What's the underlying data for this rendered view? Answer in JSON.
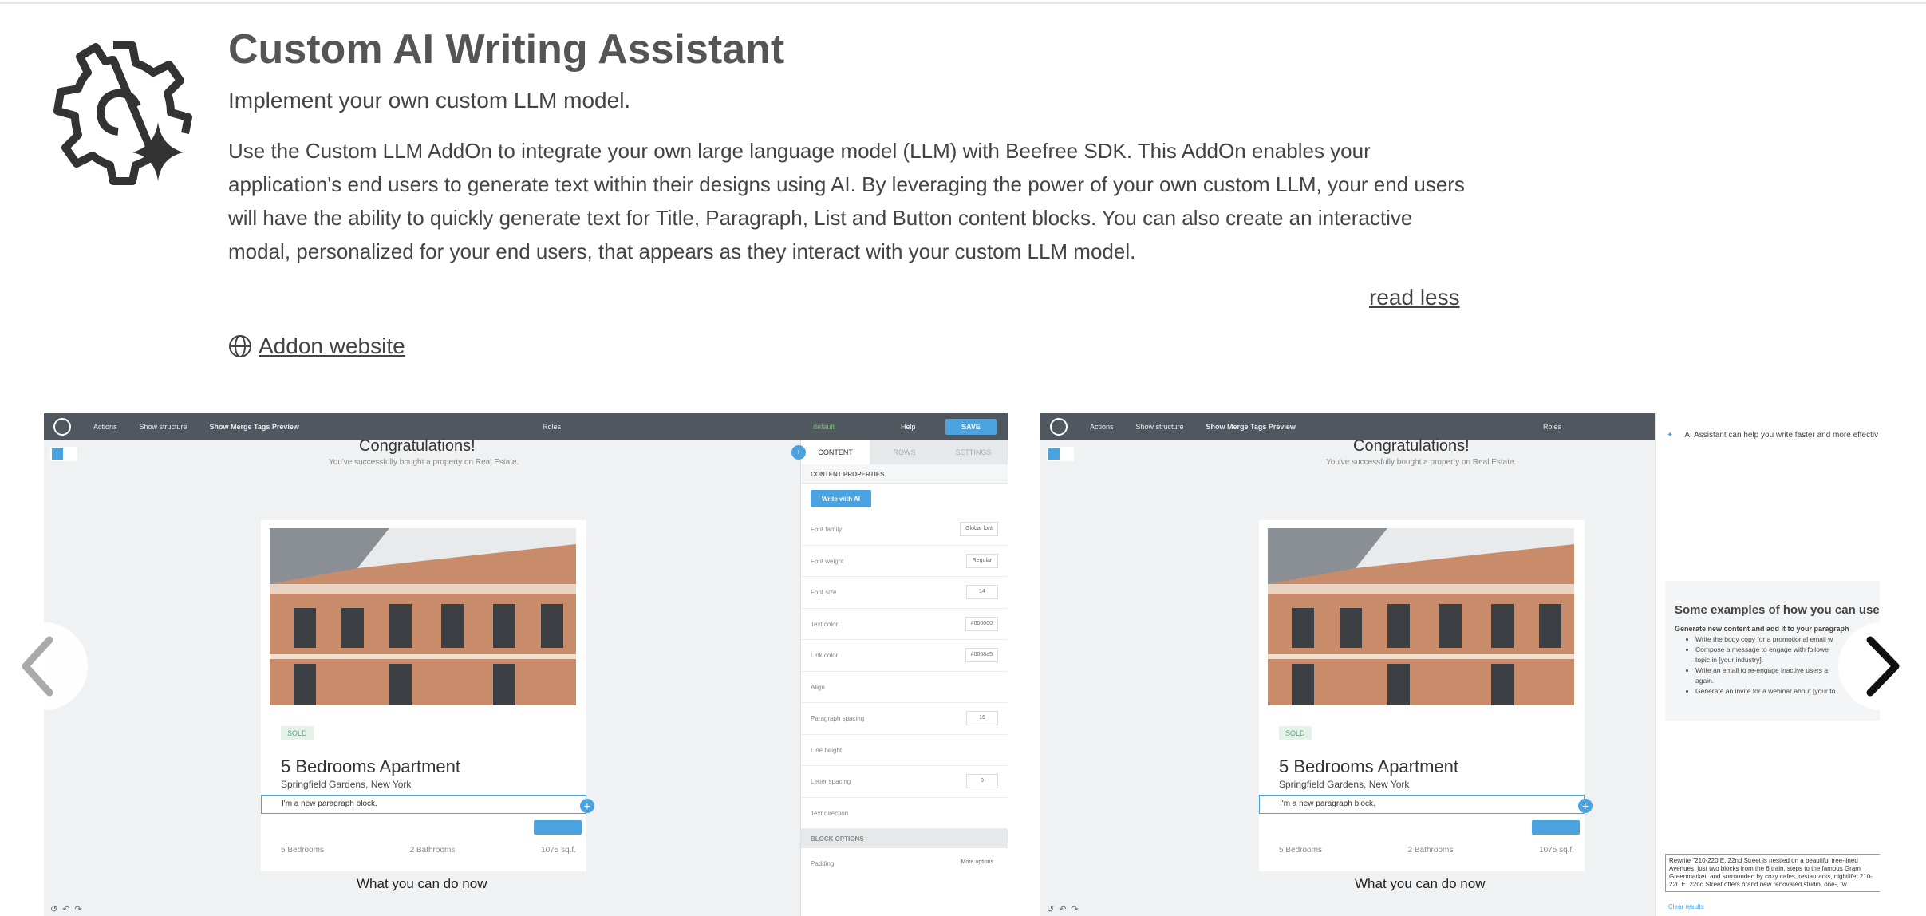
{
  "addon": {
    "title": "Custom AI Writing Assistant",
    "subtitle": "Implement your own custom LLM model.",
    "description": "Use the Custom LLM AddOn to integrate your own large language model (LLM) with Beefree SDK. This AddOn enables your application's end users to generate text within their designs using AI. By leveraging the power of your own custom LLM, your end users will have the ability to quickly generate text for Title, Paragraph, List and Button content blocks. You can also create an interactive modal, personalized for your end users, that appears as they interact with your custom LLM model.",
    "read_less": "read less",
    "website_link": "Addon website",
    "icon": "gear-sparkle-icon"
  },
  "editor": {
    "actions": "Actions",
    "show_structure": "Show structure",
    "show_merge": "Show Merge Tags Preview",
    "roles": "Roles",
    "default": "default",
    "help": "Help",
    "save": "SAVE",
    "congrats": "Congratulations!",
    "bought": "You've successfully bought a property on Real Estate.",
    "sold": "SOLD",
    "apartment": "5 Bedrooms Apartment",
    "location": "Springfield Gardens, New York",
    "paragraph": "I'm a new paragraph block.",
    "bedrooms": "5 Bedrooms",
    "bathrooms": "2 Bathrooms",
    "sqft": "1075 sq.f.",
    "what_now": "What you can do now"
  },
  "panel": {
    "tab_content": "CONTENT",
    "tab_rows": "ROWS",
    "tab_settings": "SETTINGS",
    "content_properties": "CONTENT PROPERTIES",
    "write_ai": "Write with AI",
    "rows": [
      {
        "label": "Font family",
        "value": "Global font"
      },
      {
        "label": "Font weight",
        "value": "Regular"
      },
      {
        "label": "Font size",
        "value": "14"
      },
      {
        "label": "Text color",
        "value": "#000000"
      },
      {
        "label": "Link color",
        "value": "#0068a5"
      },
      {
        "label": "Align",
        "value": ""
      },
      {
        "label": "Paragraph spacing",
        "value": "16"
      },
      {
        "label": "Line height",
        "value": ""
      },
      {
        "label": "Letter spacing",
        "value": "0"
      },
      {
        "label": "Text direction",
        "value": ""
      }
    ],
    "block_options": "BLOCK OPTIONS",
    "padding": "Padding",
    "more_options": "More options"
  },
  "ai_panel": {
    "intro": "AI Assistant can help you write faster and more effectiv",
    "examples_title": "Some examples of how you can use",
    "generate": "Generate new content and add it to your paragraph",
    "items": [
      "Write the body copy for a promotional email w",
      "Compose a message to engage with followe",
      "topic in [your industry].",
      "Write an email to re-engage inactive users a",
      "again.",
      "Generate an invite for a webinar about [your to"
    ],
    "rewrite": "Rewrite \"210-220 E. 22nd Street is nestled on a beautiful tree-lined Avenues, just two blocks from the 6 train, steps to the famous Gram Greenmarket, and surrounded by cozy cafes, restaurants, nightlife, 210-220 E. 22nd Street offers brand new renovated studio, one-, tw",
    "clear": "Clear results"
  },
  "colors": {
    "accent": "#4aa3df",
    "toolbar": "#50575e",
    "title": "#555555"
  }
}
